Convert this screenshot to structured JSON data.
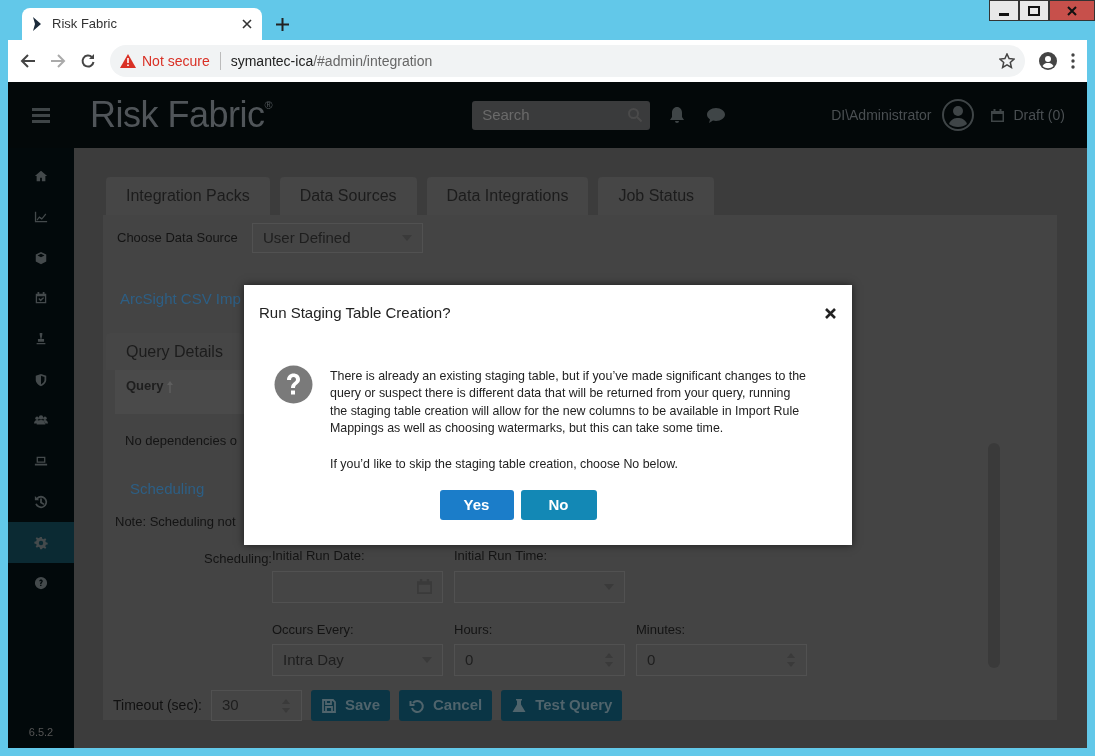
{
  "browser": {
    "tab_title": "Risk Fabric",
    "security": "Not secure",
    "url_host": "symantec-ica",
    "url_path": "/#admin/integration"
  },
  "header": {
    "logo": "Risk Fabric",
    "logo_mark": "®",
    "search": {
      "placeholder": "Search"
    },
    "user": "DI\\Administrator",
    "draft": "Draft (0)"
  },
  "sidebar": {
    "items": [
      {
        "kind": "home",
        "selected": false
      },
      {
        "kind": "chart",
        "selected": false
      },
      {
        "kind": "cube",
        "selected": false
      },
      {
        "kind": "calendar",
        "selected": false
      },
      {
        "kind": "stamp",
        "selected": false
      },
      {
        "kind": "shield",
        "selected": false
      },
      {
        "kind": "users",
        "selected": false
      },
      {
        "kind": "laptop",
        "selected": false
      },
      {
        "kind": "history",
        "selected": false
      },
      {
        "kind": "gear",
        "selected": true
      },
      {
        "kind": "help",
        "selected": false
      }
    ],
    "version": "6.5.2"
  },
  "tabs": [
    {
      "label": "Integration Packs"
    },
    {
      "label": "Data Sources"
    },
    {
      "label": "Data Integrations"
    },
    {
      "label": "Job Status"
    }
  ],
  "data_source": {
    "label": "Choose Data Source",
    "value": "User Defined"
  },
  "source_link": "ArcSight CSV Imp",
  "subtabs": [
    {
      "label": "Query Details"
    }
  ],
  "query_column": "Query",
  "dependencies_text": "No dependencies o",
  "scheduling_link": "Scheduling",
  "note": "Note: Scheduling not",
  "scheduling_label": "Scheduling:",
  "schedule_fields": [
    {
      "label": "Initial Run Date:",
      "kind": "date"
    },
    {
      "label": "Initial Run Time:",
      "kind": "select"
    },
    {
      "kind": "blank"
    },
    {
      "label": "Occurs Every:",
      "kind": "select",
      "value": "Intra Day"
    },
    {
      "label": "Hours:",
      "kind": "number",
      "value": "0"
    },
    {
      "label": "Minutes:",
      "kind": "number",
      "value": "0"
    }
  ],
  "timeout": {
    "label": "Timeout (sec):",
    "value": "30"
  },
  "actions": [
    {
      "label": "Save",
      "kind": "save"
    },
    {
      "label": "Cancel",
      "kind": "cancel"
    },
    {
      "label": "Test Query",
      "kind": "test"
    }
  ],
  "dialog": {
    "title": "Run Staging Table Creation?",
    "paragraphs": [
      "There is already an existing staging table, but if you’ve made significant changes to the query or suspect there is different data that will be returned from your query, running the staging table creation will allow for the new columns to be available in Import Rule Mappings as well as choosing watermarks, but this can take some time.",
      "If you’d like to skip the staging table creation, choose No below."
    ],
    "buttons": [
      {
        "label": "Yes",
        "kind": "primary"
      },
      {
        "label": "No",
        "kind": "secondary"
      }
    ]
  }
}
